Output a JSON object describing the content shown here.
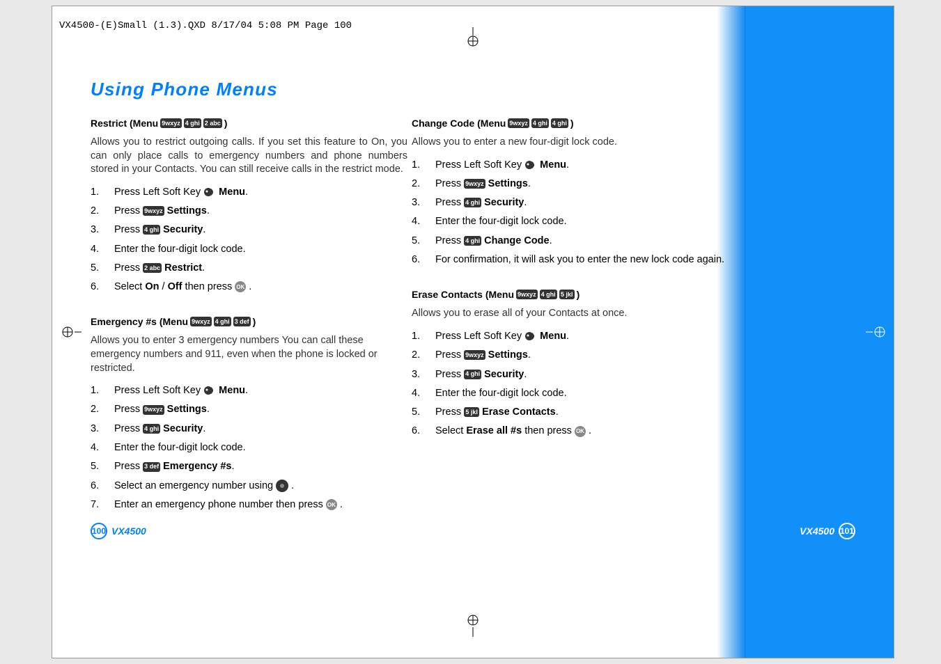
{
  "header": "VX4500-(E)Small (1.3).QXD  8/17/04  5:08 PM  Page 100",
  "title": "Using Phone Menus",
  "left": {
    "s1": {
      "title_a": "Restrict (Menu",
      "title_b": ")",
      "desc": "Allows you to restrict outgoing calls. If you set this feature to On, you can only place calls to emergency numbers and phone numbers stored in your Contacts. You can still receive calls in the restrict mode.",
      "i1a": "Press Left Soft Key ",
      "i1b": " Menu",
      "i1c": ".",
      "i2a": "Press ",
      "i2b": " Settings",
      "i2c": ".",
      "i3a": "Press ",
      "i3b": " Security",
      "i3c": ".",
      "i4": "Enter the four-digit lock code.",
      "i5a": "Press ",
      "i5b": " Restrict",
      "i5c": ".",
      "i6a": "Select ",
      "i6b": "On",
      "i6c": " / ",
      "i6d": "Off",
      "i6e": " then press ",
      "i6f": " ."
    },
    "s2": {
      "title_a": "Emergency #s (Menu",
      "title_b": ")",
      "desc": "Allows you to enter 3 emergency numbers You can call these emergency numbers and 911, even when the phone is locked or restricted.",
      "i1a": "Press Left Soft Key ",
      "i1b": " Menu",
      "i1c": ".",
      "i2a": "Press ",
      "i2b": " Settings",
      "i2c": ".",
      "i3a": "Press ",
      "i3b": " Security",
      "i3c": ".",
      "i4": "Enter the four-digit lock code.",
      "i5a": "Press ",
      "i5b": " Emergency #s",
      "i5c": ".",
      "i6a": "Select an emergency number using ",
      "i6b": " .",
      "i7a": "Enter an emergency phone number then press ",
      "i7b": " ."
    }
  },
  "right": {
    "s1": {
      "title_a": "Change Code (Menu",
      "title_b": ")",
      "desc": "Allows you to enter a new four-digit lock code.",
      "i1a": "Press Left Soft Key ",
      "i1b": " Menu",
      "i1c": ".",
      "i2a": "Press ",
      "i2b": " Settings",
      "i2c": ".",
      "i3a": "Press ",
      "i3b": " Security",
      "i3c": ".",
      "i4": "Enter the four-digit lock code.",
      "i5a": "Press ",
      "i5b": " Change Code",
      "i5c": ".",
      "i6": "For confirmation, it will ask you to enter the new lock code again."
    },
    "s2": {
      "title_a": "Erase Contacts (Menu",
      "title_b": ")",
      "desc": "Allows you to erase all of your Contacts at once.",
      "i1a": "Press Left Soft Key ",
      "i1b": " Menu",
      "i1c": ".",
      "i2a": "Press ",
      "i2b": " Settings",
      "i2c": ".",
      "i3a": "Press ",
      "i3b": " Security",
      "i3c": ".",
      "i4": "Enter the four-digit lock code.",
      "i5a": "Press ",
      "i5b": " Erase Contacts",
      "i5c": ".",
      "i6a": "Select ",
      "i6b": "Erase all #s",
      "i6c": " then press ",
      "i6d": " ."
    }
  },
  "keys": {
    "k9": "9wxyz",
    "k4": "4 ghi",
    "k2": "2 abc",
    "k3": "3 def",
    "k5": "5 jkl",
    "ok": "OK"
  },
  "footer": {
    "model": "VX4500",
    "page_left": "100",
    "page_right": "101"
  }
}
